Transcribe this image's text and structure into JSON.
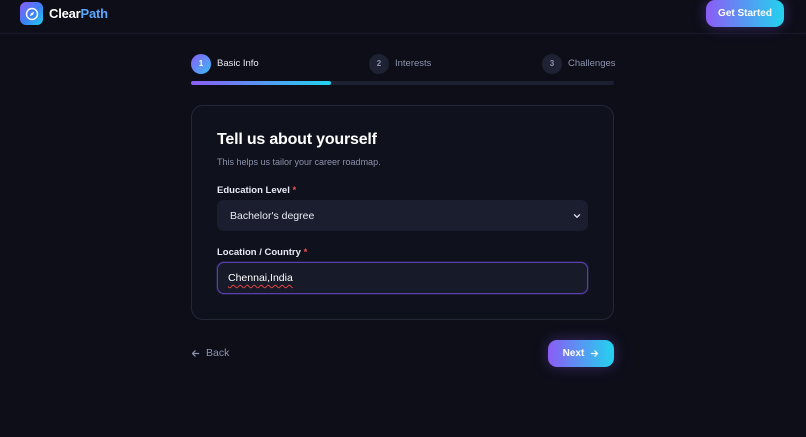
{
  "header": {
    "brand_main": "Clear",
    "brand_accent": "Path",
    "cta_label": "Get Started",
    "logo_icon": "compass-icon"
  },
  "stepper": {
    "steps": [
      {
        "number": "1",
        "label": "Basic Info",
        "state": "active"
      },
      {
        "number": "2",
        "label": "Interests",
        "state": "inactive"
      },
      {
        "number": "3",
        "label": "Challenges",
        "state": "inactive"
      }
    ],
    "progress_fraction": 0.33
  },
  "form": {
    "title": "Tell us about yourself",
    "subtitle": "This helps us tailor your career roadmap.",
    "education": {
      "label": "Education Level",
      "required_mark": "*",
      "value": "Bachelor's degree"
    },
    "location": {
      "label": "Location / Country",
      "required_mark": "*",
      "value": "Chennai,India"
    }
  },
  "nav": {
    "back_label": "Back",
    "next_label": "Next"
  },
  "colors": {
    "background": "#0d0e18",
    "accent_start": "#8b5cf6",
    "accent_end": "#22d3ee",
    "required": "#f05252"
  }
}
